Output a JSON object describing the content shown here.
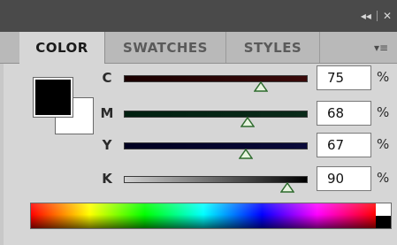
{
  "window": {
    "controls": {
      "collapse_glyph": "◂◂",
      "close_glyph": "✕"
    }
  },
  "tabs": [
    {
      "label": "COLOR",
      "active": true
    },
    {
      "label": "SWATCHES",
      "active": false
    },
    {
      "label": "STYLES",
      "active": false
    }
  ],
  "panel_menu": {
    "icon": "panel-menu-icon",
    "glyph": "▾≡"
  },
  "swatches": {
    "foreground_color": "#000000",
    "background_color": "#ffffff"
  },
  "channels": [
    {
      "label": "C",
      "value": "75",
      "unit": "%",
      "level": 0.75,
      "track_color_start": "#1a0000",
      "track_color_end": "#3a0a0a"
    },
    {
      "label": "M",
      "value": "68",
      "unit": "%",
      "level": 0.68,
      "track_color_start": "#002010",
      "track_color_end": "#0a2a1a"
    },
    {
      "label": "Y",
      "value": "67",
      "unit": "%",
      "level": 0.67,
      "track_color_start": "#000020",
      "track_color_end": "#0a0a3a"
    },
    {
      "label": "K",
      "value": "90",
      "unit": "%",
      "level": 0.9,
      "track_color_start": "#d0d0d0",
      "track_color_end": "#000000"
    }
  ],
  "colors": {
    "title_bar": "#4a4a4a",
    "tab_bar": "#b9b9b9",
    "panel": "#d6d6d6",
    "thumb_fill": "#e8f5e0",
    "thumb_stroke": "#2e6b2e"
  }
}
